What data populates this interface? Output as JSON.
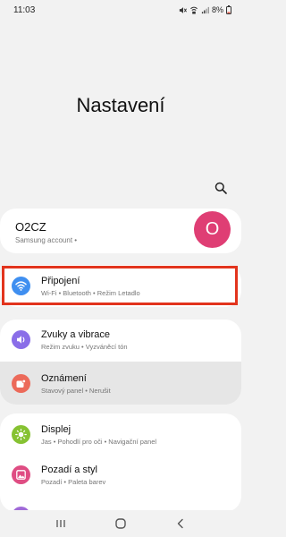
{
  "status_bar": {
    "time": "11:03",
    "battery": "8%",
    "icons": [
      "mute-icon",
      "wifi-call-icon",
      "signal-icon",
      "battery-icon"
    ]
  },
  "header": {
    "title": "Nastavení",
    "search_icon": "search-icon"
  },
  "account": {
    "name": "O2CZ",
    "subtitle": "Samsung account  •",
    "avatar_letter": "O",
    "avatar_color": "#df3e74"
  },
  "settings": [
    {
      "title": "Připojení",
      "subtitle": "Wi-Fi  •  Bluetooth  •  Režim Letadlo",
      "icon": "wifi-icon",
      "color": "#3f8ff0"
    },
    {
      "title": "Zvuky a vibrace",
      "subtitle": "Režim zvuku  •  Vyzváněcí tón",
      "icon": "volume-icon",
      "color": "#8a6ee8"
    },
    {
      "title": "Oznámení",
      "subtitle": "Stavový panel  •  Nerušit",
      "icon": "notification-icon",
      "color": "#ec6a5a"
    },
    {
      "title": "Displej",
      "subtitle": "Jas  •  Pohodlí pro oči  •  Navigační panel",
      "icon": "brightness-icon",
      "color": "#86c232"
    },
    {
      "title": "Pozadí a styl",
      "subtitle": "Pozadí  •  Paleta barev",
      "icon": "wallpaper-icon",
      "color": "#df4d83"
    }
  ],
  "highlight_color": "#e2341d",
  "nav_bar": {
    "buttons": [
      "recents-icon",
      "home-icon",
      "back-icon"
    ]
  }
}
